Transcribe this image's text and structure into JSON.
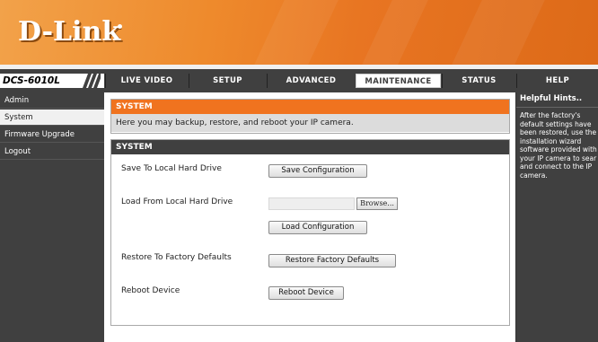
{
  "brand": {
    "logo_text": "D-Link",
    "accent_color": "#f0731f",
    "dark_color": "#404040"
  },
  "model": "DCS-6010L",
  "nav": {
    "tabs": [
      {
        "label": "LIVE VIDEO",
        "active": false
      },
      {
        "label": "SETUP",
        "active": false
      },
      {
        "label": "ADVANCED",
        "active": false
      },
      {
        "label": "MAINTENANCE",
        "active": true
      },
      {
        "label": "STATUS",
        "active": false
      },
      {
        "label": "HELP",
        "active": false
      }
    ]
  },
  "sidebar": {
    "items": [
      {
        "label": "Admin",
        "active": false
      },
      {
        "label": "System",
        "active": true
      },
      {
        "label": "Firmware Upgrade",
        "active": false
      },
      {
        "label": "Logout",
        "active": false
      }
    ]
  },
  "intro": {
    "title": "SYSTEM",
    "text": "Here you may backup, restore, and reboot your IP camera."
  },
  "system": {
    "title": "SYSTEM",
    "save_label": "Save To Local Hard Drive",
    "save_button": "Save Configuration",
    "load_label": "Load From Local Hard Drive",
    "file_value": "",
    "browse_button": "Browse...",
    "load_button": "Load Configuration",
    "restore_label": "Restore To Factory Defaults",
    "restore_button": "Restore Factory Defaults",
    "reboot_label": "Reboot Device",
    "reboot_button": "Reboot Device"
  },
  "hints": {
    "title": "Helpful Hints..",
    "text": "After the factory's\ndefault settings have\nbeen restored, use the\ninstallation wizard\nsoftware provided with\nyour IP camera to sear\nand connect to the IP\ncamera."
  }
}
